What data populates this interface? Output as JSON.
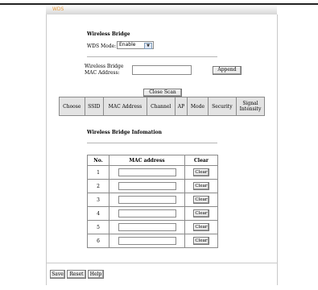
{
  "window": {
    "title": "WDS"
  },
  "bridge": {
    "heading": "Wireless Bridge",
    "mode_label": "WDS Mode:",
    "mode_value": "Enable",
    "mac_label_1": "Wireless Bridge",
    "mac_label_2": "MAC Address:",
    "mac_value": "",
    "append_label": "Append"
  },
  "scan": {
    "close_label": "Close Scan",
    "columns": [
      "Choose",
      "SSID",
      "MAC Address",
      "Channel",
      "AP",
      "Mode",
      "Security",
      "Signal Intensity"
    ]
  },
  "info": {
    "heading": "Wireless Bridge Infomation",
    "col_no": "No.",
    "col_mac": "MAC address",
    "col_clear": "Clear",
    "rows": [
      {
        "no": "1",
        "mac": "",
        "clear": "Clear"
      },
      {
        "no": "2",
        "mac": "",
        "clear": "Clear"
      },
      {
        "no": "3",
        "mac": "",
        "clear": "Clear"
      },
      {
        "no": "4",
        "mac": "",
        "clear": "Clear"
      },
      {
        "no": "5",
        "mac": "",
        "clear": "Clear"
      },
      {
        "no": "6",
        "mac": "",
        "clear": "Clear"
      }
    ]
  },
  "footer": {
    "save": "Save",
    "reset": "Reset",
    "help": "Help"
  }
}
